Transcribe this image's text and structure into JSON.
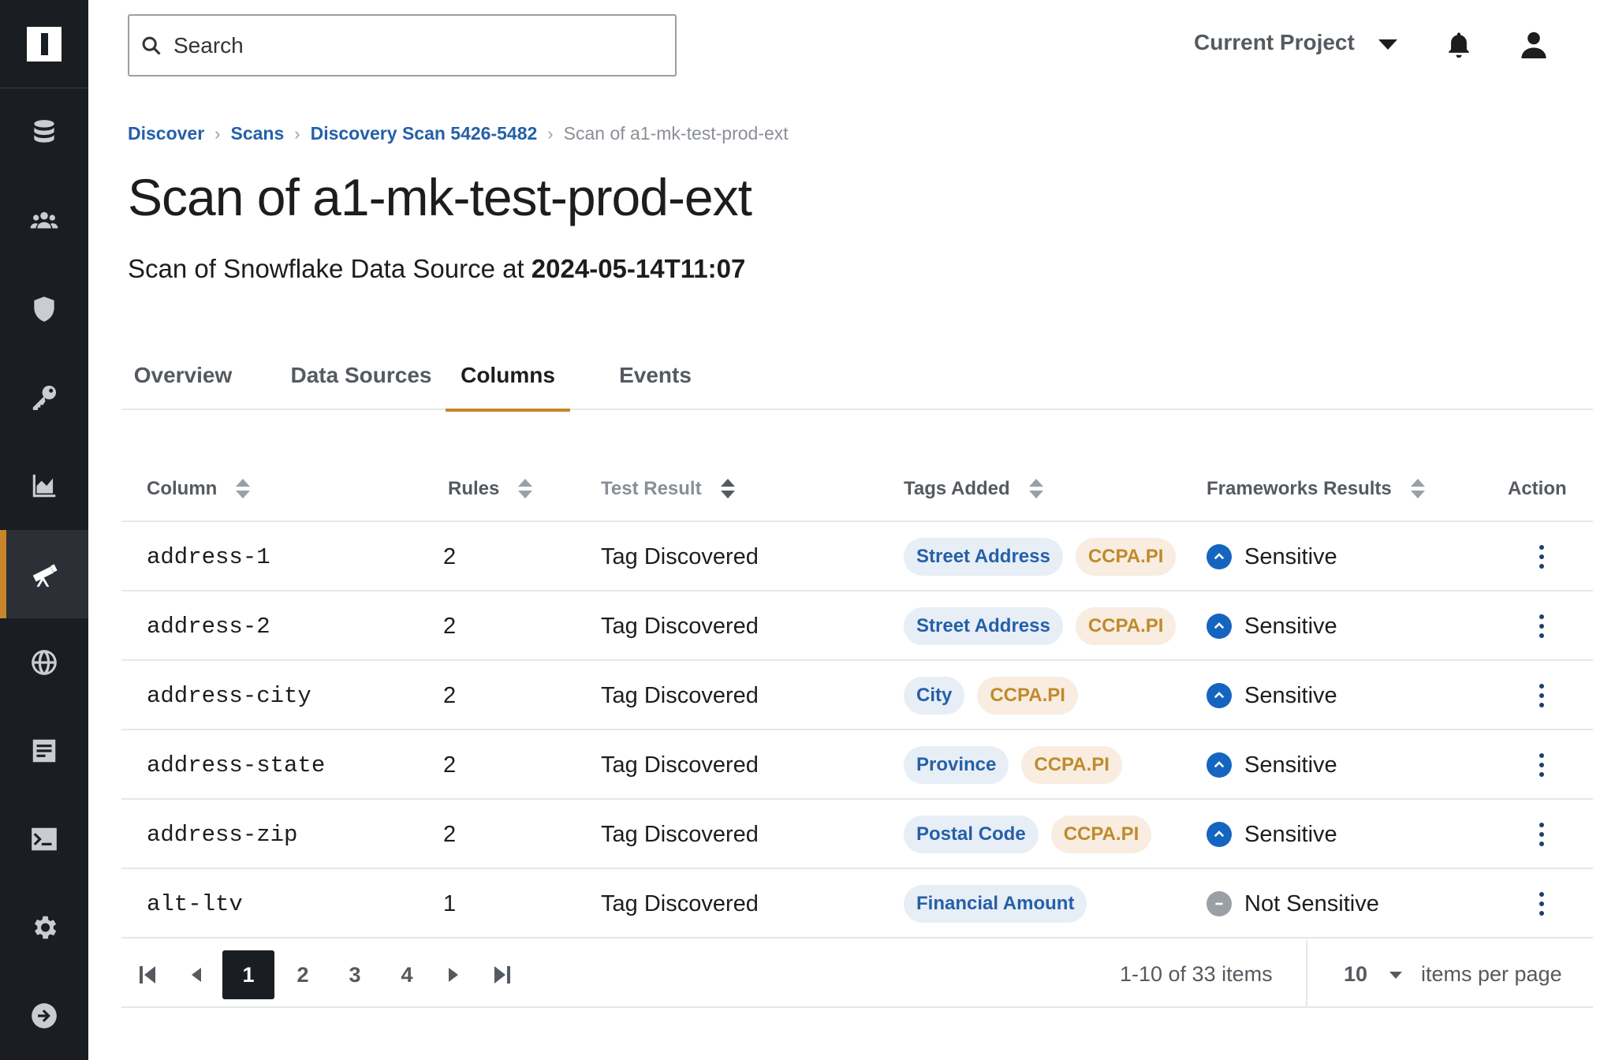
{
  "search": {
    "placeholder": "Search"
  },
  "header": {
    "project_label": "Current Project"
  },
  "breadcrumb": {
    "items": [
      "Discover",
      "Scans",
      "Discovery Scan 5426-5482"
    ],
    "current": "Scan of a1-mk-test-prod-ext"
  },
  "page": {
    "title": "Scan of a1-mk-test-prod-ext",
    "subtitle_prefix": "Scan of Snowflake Data Source at ",
    "subtitle_timestamp": "2024-05-14T11:07"
  },
  "tabs": [
    {
      "label": "Overview"
    },
    {
      "label": "Data Sources"
    },
    {
      "label": "Columns",
      "active": true
    },
    {
      "label": "Events"
    }
  ],
  "table": {
    "headers": {
      "column": "Column",
      "rules": "Rules",
      "test_result": "Test Result",
      "tags_added": "Tags Added",
      "frameworks_results": "Frameworks Results",
      "action": "Action"
    },
    "rows": [
      {
        "column": "address-1",
        "rules": "2",
        "test_result": "Tag Discovered",
        "tags": [
          "Street Address",
          "CCPA.PI"
        ],
        "framework": "Sensitive"
      },
      {
        "column": "address-2",
        "rules": "2",
        "test_result": "Tag Discovered",
        "tags": [
          "Street Address",
          "CCPA.PI"
        ],
        "framework": "Sensitive"
      },
      {
        "column": "address-city",
        "rules": "2",
        "test_result": "Tag Discovered",
        "tags": [
          "City",
          "CCPA.PI"
        ],
        "framework": "Sensitive"
      },
      {
        "column": "address-state",
        "rules": "2",
        "test_result": "Tag Discovered",
        "tags": [
          "Province",
          "CCPA.PI"
        ],
        "framework": "Sensitive"
      },
      {
        "column": "address-zip",
        "rules": "2",
        "test_result": "Tag Discovered",
        "tags": [
          "Postal Code",
          "CCPA.PI"
        ],
        "framework": "Sensitive"
      },
      {
        "column": "alt-ltv",
        "rules": "1",
        "test_result": "Tag Discovered",
        "tags": [
          "Financial Amount"
        ],
        "framework": "Not Sensitive"
      }
    ]
  },
  "pagination": {
    "pages": [
      "1",
      "2",
      "3",
      "4"
    ],
    "current_page": "1",
    "count_text": "1-10 of 33 items",
    "per_page_value": "10",
    "per_page_label": "items per page"
  },
  "colors": {
    "sidebar_bg": "#1a1d21",
    "accent": "#c7862a",
    "link": "#2560a8",
    "tag_blue_bg": "#e8eef6",
    "tag_gold_bg": "#f8ede0",
    "sensitive_icon": "#1565c0"
  },
  "icons": {
    "sidebar": [
      "logo",
      "database-icon",
      "users-icon",
      "shield-icon",
      "key-icon",
      "chart-icon",
      "telescope-icon",
      "globe-icon",
      "document-icon",
      "terminal-icon",
      "gear-icon",
      "arrow-right-circle-icon"
    ],
    "header": [
      "search-icon",
      "chevron-down-icon",
      "bell-icon",
      "user-icon"
    ]
  }
}
